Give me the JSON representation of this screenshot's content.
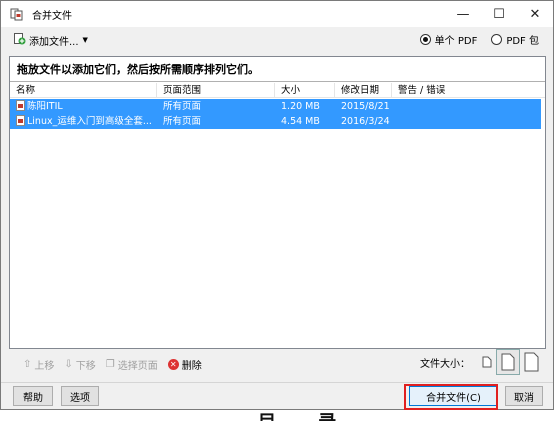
{
  "window": {
    "title": "合并文件",
    "controls": {
      "minimize": "—",
      "maximize": "☐",
      "close": "✕"
    }
  },
  "toolbar": {
    "add_files_label": "添加文件...",
    "output_options": [
      {
        "label": "单个 PDF",
        "selected": true
      },
      {
        "label": "PDF 包",
        "selected": false
      }
    ]
  },
  "panel": {
    "instruction": "拖放文件以添加它们，然后按所需顺序排列它们。",
    "columns": [
      "名称",
      "页面范围",
      "大小",
      "修改日期",
      "警告 / 错误"
    ],
    "rows": [
      {
        "name": "陈阳ITIL",
        "page_range": "所有页面",
        "size": "1.20 MB",
        "modified": "2015/8/21 ...",
        "warning": "",
        "selected": true
      },
      {
        "name": "Linux_运维入门到高级全套...",
        "page_range": "所有页面",
        "size": "4.54 MB",
        "modified": "2016/3/24 ...",
        "warning": "",
        "selected": true
      }
    ]
  },
  "actions": {
    "move_up": "上移",
    "move_down": "下移",
    "choose_pages": "选择页面",
    "delete": "删除"
  },
  "file_size": {
    "label": "文件大小：",
    "options": [
      "small-page-icon",
      "default-page-icon",
      "large-page-icon"
    ],
    "selected_index": 1
  },
  "footer": {
    "help": "帮助",
    "options": "选项",
    "merge": "合并文件(C)",
    "cancel": "取消"
  },
  "background_text": "目 录",
  "colors": {
    "selection": "#3399ff",
    "highlight_box": "#e02020",
    "dialog_bg": "#f0f0f0"
  }
}
